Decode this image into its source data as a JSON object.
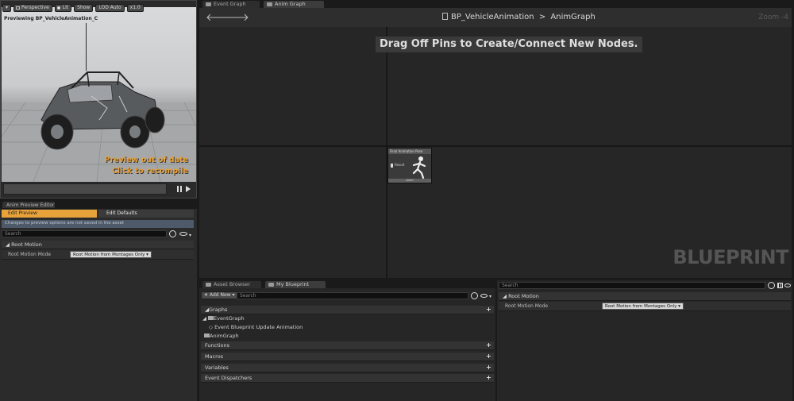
{
  "viewport": {
    "toolbar": {
      "menu_label": "▾",
      "perspective": "Perspective",
      "lit": "Lit",
      "show": "Show",
      "lod": "LOD Auto",
      "speed": "x1.0"
    },
    "previewing": "Previewing BP_VehicleAnimation_C",
    "out_of_date_line1": "Preview out of date",
    "out_of_date_line2": "Click to recompile",
    "pause_icon": "pause-icon",
    "step_icon": "step-forward-icon"
  },
  "anim_preview_editor": {
    "tab": "Anim Preview Editor",
    "left_toggle": "Edit Preview",
    "right_toggle": "Edit Defaults",
    "info": "Changes to preview options are not saved in the asset",
    "search_placeholder": "Search",
    "category": "Root Motion",
    "property_label": "Root Motion Mode",
    "property_value": "Root Motion from Montages Only ▾"
  },
  "graph_tabs": [
    {
      "label": "Event Graph",
      "active": false
    },
    {
      "label": "Anim Graph",
      "active": true
    }
  ],
  "graph": {
    "breadcrumb_asset": "BP_VehicleAnimation",
    "breadcrumb_sep": ">",
    "breadcrumb_graph": "AnimGraph",
    "zoom": "Zoom -4",
    "hint": "Drag Off Pins to Create/Connect New Nodes.",
    "watermark": "BLUEPRINT",
    "node_title": "Final Animation Pose",
    "node_pin": "Result",
    "node_footer": "Anim"
  },
  "bottom_tabs": [
    {
      "label": "Asset Browser",
      "active": false
    },
    {
      "label": "My Blueprint",
      "active": true
    }
  ],
  "my_blueprint": {
    "add_new": "Add New ▾",
    "search_placeholder": "Search",
    "graphs_header": "Graphs",
    "event_graph": "EventGraph",
    "event_item": "Event Blueprint Update Animation",
    "anim_graph": "AnimGraph",
    "functions": "Functions",
    "macros": "Macros",
    "variables": "Variables",
    "event_dispatchers": "Event Dispatchers"
  },
  "details": {
    "search_placeholder": "Search",
    "category": "Root Motion",
    "property_label": "Root Motion Mode",
    "property_value": "Root Motion from Montages Only ▾"
  },
  "colors": {
    "accent_orange": "#e8a23a",
    "graph_bg": "#262626"
  }
}
